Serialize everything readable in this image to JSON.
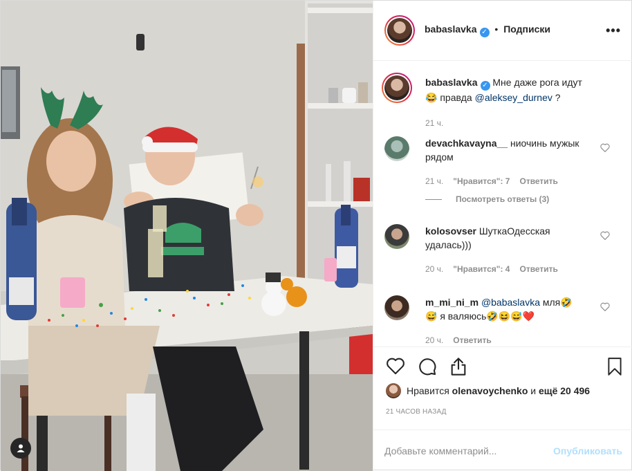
{
  "post": {
    "username": "babaslavka",
    "follow_label": "Подписки",
    "dot": "•",
    "more": "•••"
  },
  "caption": {
    "username": "babaslavka",
    "text_1": "Мне даже рога идут",
    "emoji": "😂",
    "text_2": "правда",
    "mention": "@aleksey_durnev",
    "text_3": "?",
    "time": "21 ч."
  },
  "comments": [
    {
      "username": "devachkavayna__",
      "text": "ниочинь мужык рядом",
      "time": "21 ч.",
      "likes": "\"Нравится\": 7",
      "reply": "Ответить",
      "view_replies": "Посмотреть ответы (3)"
    },
    {
      "username": "kolosovser",
      "text": "ШуткаОдесская удалась)))",
      "time": "20 ч.",
      "likes": "\"Нравится\": 4",
      "reply": "Ответить"
    },
    {
      "username": "m_mi_ni_m",
      "mention": "@babaslavka",
      "text": "мля🤣",
      "text_2": "😅 я валяюсь🤣😆😅❤️",
      "time": "20 ч.",
      "reply": "Ответить"
    }
  ],
  "likes": {
    "prefix": "Нравится",
    "user": "olenavoychenko",
    "middle": "и",
    "count": "ещё 20 496"
  },
  "timestamp": "21 ЧАСОВ НАЗАД",
  "comment_box": {
    "placeholder": "Добавьте комментарий...",
    "publish": "Опубликовать"
  },
  "colors": {
    "verified": "#3897f0",
    "mention": "#003569",
    "meta": "#8e8e8e",
    "publish_disabled": "#b2dffc"
  },
  "icons": [
    "heart-icon",
    "comment-icon",
    "share-icon",
    "bookmark-icon",
    "user-tag-icon",
    "verified-icon"
  ]
}
